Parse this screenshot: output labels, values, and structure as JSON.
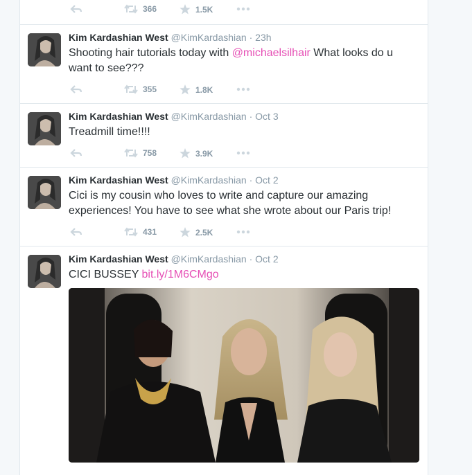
{
  "colors": {
    "link": "#e64fb5",
    "muted": "#8899a6",
    "text": "#292f33"
  },
  "top_tweet": {
    "retweets": "366",
    "favorites": "1.5K"
  },
  "tweets": [
    {
      "fullname": "Kim Kardashian West",
      "username": "@KimKardashian",
      "time": "· 23h",
      "text_before": "Shooting hair tutorials today with ",
      "mention": "@michaelsilhair",
      "text_after": " What looks do u want to see???",
      "retweets": "355",
      "favorites": "1.8K"
    },
    {
      "fullname": "Kim Kardashian West",
      "username": "@KimKardashian",
      "time": "· Oct 3",
      "text": "Treadmill time!!!!",
      "retweets": "758",
      "favorites": "3.9K"
    },
    {
      "fullname": "Kim Kardashian West",
      "username": "@KimKardashian",
      "time": "· Oct 2",
      "text": "Cici is my cousin who loves to write and capture our amazing experiences! You have to see what she wrote about our Paris trip!",
      "retweets": "431",
      "favorites": "2.5K"
    },
    {
      "fullname": "Kim Kardashian West",
      "username": "@KimKardashian",
      "time": "· Oct 2",
      "text": "CICI BUSSEY ",
      "link": "bit.ly/1M6CMgo"
    }
  ],
  "icons": {
    "reply": "reply-icon",
    "retweet": "retweet-icon",
    "favorite": "star-icon",
    "more": "more-icon"
  }
}
